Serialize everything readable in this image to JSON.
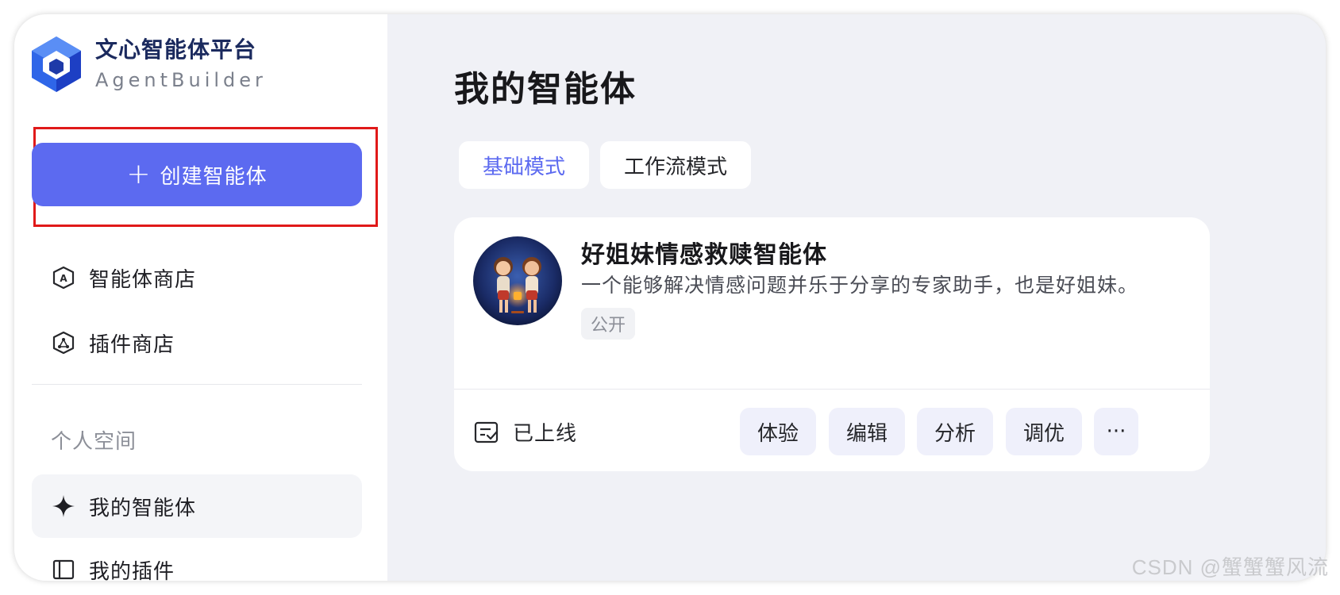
{
  "brand": {
    "title": "文心智能体平台",
    "subtitle": "AgentBuilder"
  },
  "sidebar": {
    "create_button": {
      "label": "创建智能体",
      "icon": "plus-icon"
    },
    "items": [
      {
        "label": "智能体商店",
        "icon": "agent-store-icon"
      },
      {
        "label": "插件商店",
        "icon": "plugin-store-icon"
      }
    ],
    "section_label": "个人空间",
    "personal_items": [
      {
        "label": "我的智能体",
        "icon": "sparkle-icon",
        "active": true
      },
      {
        "label": "我的插件",
        "icon": "book-icon"
      }
    ]
  },
  "main": {
    "title": "我的智能体",
    "tabs": [
      {
        "label": "基础模式",
        "active": true
      },
      {
        "label": "工作流模式",
        "active": false
      }
    ],
    "agent_card": {
      "name": "好姐妹情感救赎智能体",
      "description": "一个能够解决情感问题并乐于分享的专家助手，也是好姐妹。",
      "tag": "公开",
      "status": "已上线",
      "actions": [
        "体验",
        "编辑",
        "分析",
        "调优"
      ],
      "more_label": "···"
    }
  },
  "watermark": "CSDN @蟹蟹蟹风流",
  "colors": {
    "accent": "#5c6af0",
    "highlight_border": "#e01919",
    "main_bg": "#f0f1f6",
    "action_bg": "#eff0fb"
  }
}
